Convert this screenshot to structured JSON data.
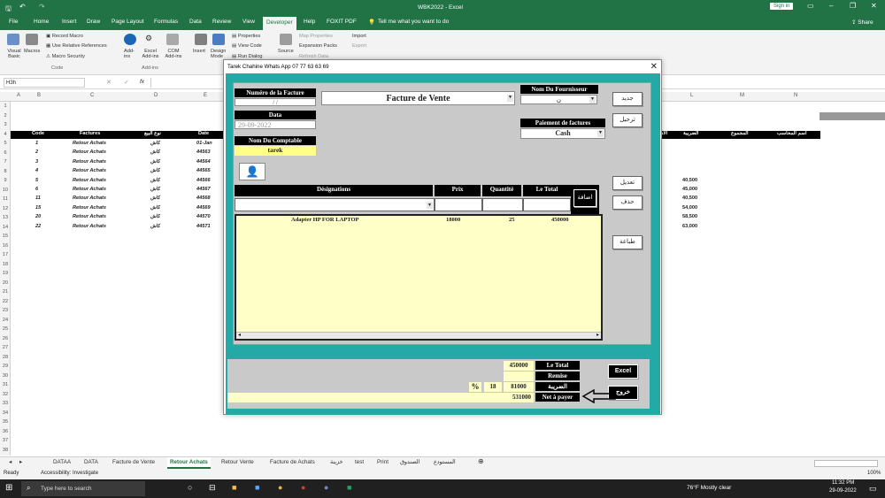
{
  "window": {
    "title": "WBK2022 - Excel",
    "sign_in": "Sign in",
    "share": "Share"
  },
  "ribbon_tabs": [
    "File",
    "Home",
    "Insert",
    "Draw",
    "Page Layout",
    "Formulas",
    "Data",
    "Review",
    "View",
    "Developer",
    "Help",
    "FOXIT PDF"
  ],
  "tell_me": "Tell me what you want to do",
  "ribbon": {
    "visual_basic": "Visual Basic",
    "macros": "Macros",
    "record_macro": "Record Macro",
    "use_relative": "Use Relative References",
    "macro_security": "Macro Security",
    "code_group": "Code",
    "addins": "Add-ins",
    "excel_addins": "Excel Add-ins",
    "com_addins": "COM Add-ins",
    "addins_group": "Add-ins",
    "insert": "Insert",
    "design_mode": "Design Mode",
    "properties": "Properties",
    "view_code": "View Code",
    "run_dialog": "Run Dialog",
    "source": "Source",
    "map_properties": "Map Properties",
    "expansion_packs": "Expansion Packs",
    "refresh_data": "Refresh Data",
    "import": "Import",
    "export": "Export"
  },
  "namebox": "H3h",
  "fx": "fx",
  "columns": [
    "A",
    "B",
    "C",
    "D",
    "E",
    "L",
    "M",
    "N"
  ],
  "rows": [
    "1",
    "2",
    "3",
    "4",
    "5",
    "6",
    "7",
    "8",
    "9",
    "10",
    "11",
    "12",
    "13",
    "14",
    "15",
    "16",
    "17",
    "18",
    "19",
    "20",
    "21",
    "22",
    "23",
    "24",
    "25",
    "26",
    "27",
    "28",
    "29",
    "30",
    "31",
    "32",
    "33",
    "34",
    "35",
    "36",
    "37",
    "38"
  ],
  "sheet_headers": {
    "code": "Code",
    "factures": "Factures",
    "type": "نوع البيع",
    "date": "Date",
    "tax": "الضريبة",
    "total": "المجموع",
    "accountant": "اسم المحاسب",
    "cut": "الاد"
  },
  "sheet_rows": [
    {
      "code": "1",
      "facture": "Retour Achats",
      "type": "كاش",
      "date": "01-Jan",
      "amount": ""
    },
    {
      "code": "2",
      "facture": "Retour Achats",
      "type": "كاش",
      "date": "44563",
      "amount": ""
    },
    {
      "code": "3",
      "facture": "Retour Achats",
      "type": "كاش",
      "date": "44564",
      "amount": ""
    },
    {
      "code": "4",
      "facture": "Retour Achats",
      "type": "كاش",
      "date": "44565",
      "amount": ""
    },
    {
      "code": "5",
      "facture": "Retour Achats",
      "type": "كاش",
      "date": "44566",
      "amount": "40,500"
    },
    {
      "code": "6",
      "facture": "Retour Achats",
      "type": "كاش",
      "date": "44567",
      "amount": "45,000"
    },
    {
      "code": "11",
      "facture": "Retour Achats",
      "type": "كاش",
      "date": "44568",
      "amount": "40,500"
    },
    {
      "code": "15",
      "facture": "Retour Achats",
      "type": "كاش",
      "date": "44569",
      "amount": "54,000"
    },
    {
      "code": "20",
      "facture": "Retour Achats",
      "type": "كاش",
      "date": "44570",
      "amount": "58,500"
    },
    {
      "code": "22",
      "facture": "Retour Achats",
      "type": "كاش",
      "date": "44571",
      "amount": "63,000"
    }
  ],
  "sheet_tabs": [
    "DATAA",
    "DATA",
    "Facture de Vente",
    "Retour Achats",
    "Retour Vente",
    "Facture de Achats",
    "خزينة",
    "test",
    "Print",
    "الصندوق",
    "المستودع"
  ],
  "status": {
    "ready": "Ready",
    "accessibility": "Accessibility: Investigate",
    "zoom": "100%"
  },
  "taskbar": {
    "search": "Type here to search",
    "weather": "76°F  Mostly clear",
    "time": "11:32 PM",
    "date": "29-09-2022"
  },
  "dialog": {
    "title": "Tarek Chahine Whats App 07 77 63 63 69",
    "numero_label": "Numéro de la Facture",
    "numero_value": "/ /",
    "data_label": "Data",
    "data_value": "29-09-2022",
    "comptable_label": "Nom Du Comptable",
    "comptable_value": "tarek",
    "facture_type": "Facture de Vente",
    "fournisseur_label": "Nom Du Fournisseur",
    "fournisseur_value": "ن",
    "paiement_label": "Paiement de factures",
    "paiement_value": "Cash",
    "col_designations": "Désignations",
    "col_prix": "Prix",
    "col_quantite": "Quantité",
    "col_total": "Le Total",
    "add_button": "اضافة",
    "btn_new": "جديد",
    "btn_save": "ترحيل",
    "btn_edit": "تعديل",
    "btn_delete": "حذف",
    "btn_print": "طباعة",
    "btn_excel": "Excel",
    "btn_exit": "خروج",
    "items": [
      {
        "designation": "Adapter HP FOR LAPTOP",
        "prix": "18000",
        "quantite": "25",
        "total": "450000"
      }
    ],
    "totals": {
      "le_total_label": "Le Total",
      "le_total_value": "450000",
      "remise_label": "Remise",
      "remise_value": "",
      "tax_label": "الضريبة",
      "tax_value": "81000",
      "tax_rate": "18",
      "percent": "%",
      "net_label": "Net à payer",
      "net_value": "531000"
    }
  }
}
